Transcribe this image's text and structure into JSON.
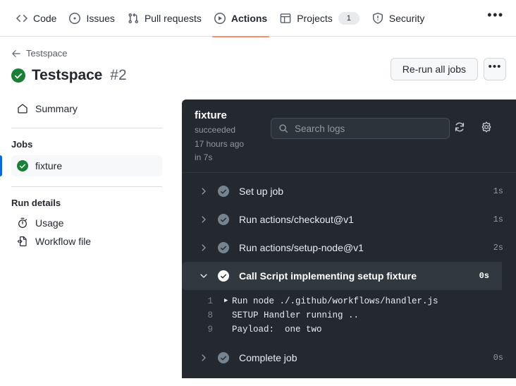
{
  "repo_nav": {
    "items": [
      {
        "label": "Code",
        "icon": "code-icon",
        "selected": false,
        "count": null
      },
      {
        "label": "Issues",
        "icon": "issue-opened-icon",
        "selected": false,
        "count": null
      },
      {
        "label": "Pull requests",
        "icon": "git-pull-request-icon",
        "selected": false,
        "count": null
      },
      {
        "label": "Actions",
        "icon": "play-icon",
        "selected": true,
        "count": null
      },
      {
        "label": "Projects",
        "icon": "project-icon",
        "selected": false,
        "count": "1"
      },
      {
        "label": "Security",
        "icon": "shield-icon",
        "selected": false,
        "count": null
      }
    ],
    "more_label": "•••",
    "selected_underline_color": "#fd8c73"
  },
  "run_header": {
    "breadcrumb_label": "Testspace",
    "title": "Testspace",
    "run_number": "#2",
    "status": "success",
    "status_color": "#1a7f37",
    "rerun_label": "Re-run all jobs",
    "more_label": "•••"
  },
  "sidebar": {
    "summary_label": "Summary",
    "jobs_heading": "Jobs",
    "jobs": [
      {
        "label": "fixture",
        "status": "success",
        "selected": true
      }
    ],
    "run_details_heading": "Run details",
    "details": [
      {
        "label": "Usage",
        "icon": "stopwatch-icon"
      },
      {
        "label": "Workflow file",
        "icon": "file-code-icon"
      }
    ],
    "selected_indicator_color": "#0969da"
  },
  "logs": {
    "job_name": "fixture",
    "status": "succeeded",
    "when": "17 hours ago",
    "duration": "in 7s",
    "search_placeholder": "Search logs",
    "search_value": "",
    "refresh_icon": "sync-icon",
    "settings_icon": "gear-icon",
    "panel_bg": "#24292f",
    "steps": [
      {
        "name": "Set up job",
        "time": "1s",
        "expanded": false,
        "status": "success"
      },
      {
        "name": "Run actions/checkout@v1",
        "time": "1s",
        "expanded": false,
        "status": "success"
      },
      {
        "name": "Run actions/setup-node@v1",
        "time": "2s",
        "expanded": false,
        "status": "success"
      },
      {
        "name": "Call Script implementing setup fixture",
        "time": "0s",
        "expanded": true,
        "status": "success"
      },
      {
        "name": "Complete job",
        "time": "0s",
        "expanded": false,
        "status": "success"
      }
    ],
    "expanded_step_lines": [
      {
        "num": "1",
        "caret": true,
        "text": "Run node ./.github/workflows/handler.js"
      },
      {
        "num": "8",
        "caret": false,
        "text": "SETUP Handler running .."
      },
      {
        "num": "9",
        "caret": false,
        "text": "Payload:  one two"
      }
    ]
  }
}
